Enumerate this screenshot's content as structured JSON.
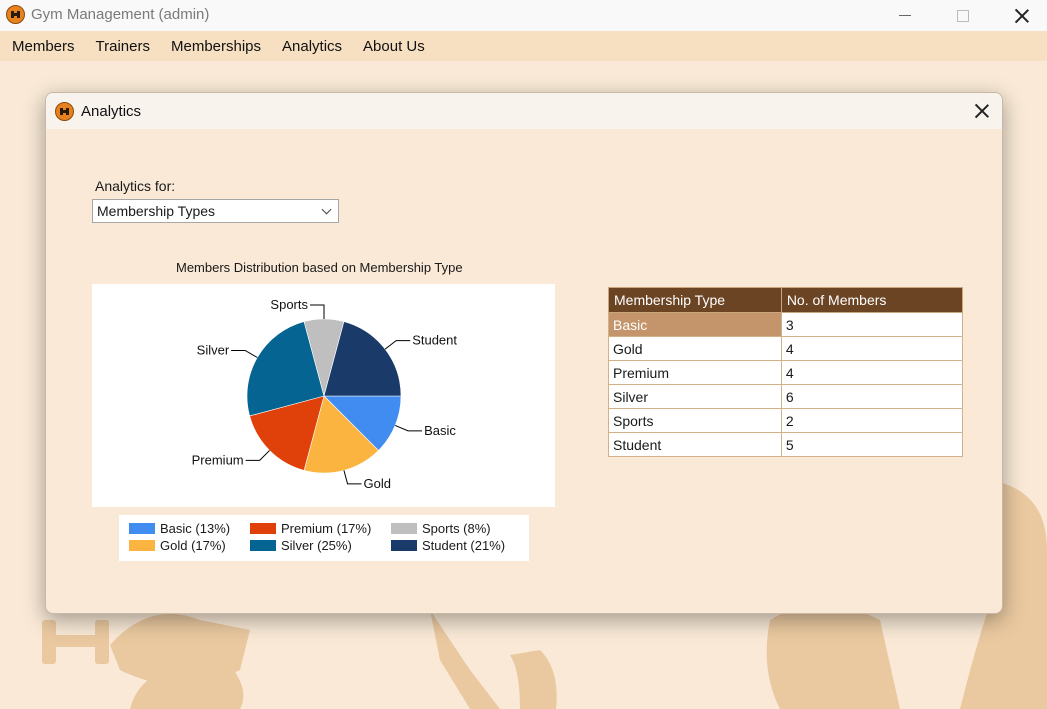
{
  "window": {
    "title": "Gym Management (admin)"
  },
  "menu": [
    "Members",
    "Trainers",
    "Memberships",
    "Analytics",
    "About Us"
  ],
  "dialog": {
    "title": "Analytics",
    "analytics_for_label": "Analytics for:",
    "selected_option": "Membership Types"
  },
  "table": {
    "headers": [
      "Membership Type",
      "No. of Members"
    ],
    "rows": [
      [
        "Basic",
        "3"
      ],
      [
        "Gold",
        "4"
      ],
      [
        "Premium",
        "4"
      ],
      [
        "Silver",
        "6"
      ],
      [
        "Sports",
        "2"
      ],
      [
        "Student",
        "5"
      ]
    ],
    "selected_row": 0
  },
  "colors": {
    "menu_bar": "#f7dfc1",
    "header": "#6b4423",
    "selected": "#c4956a"
  },
  "chart_data": {
    "type": "pie",
    "title": "Members Distribution based on Membership Type",
    "categories": [
      "Basic",
      "Gold",
      "Premium",
      "Silver",
      "Sports",
      "Student"
    ],
    "values": [
      3,
      4,
      4,
      6,
      2,
      5
    ],
    "colors": [
      "#418cf0",
      "#fcb441",
      "#e0400a",
      "#056492",
      "#bfbfbf",
      "#1a3b69"
    ],
    "legend": [
      "Basic (13%)",
      "Premium (17%)",
      "Sports (8%)",
      "Gold (17%)",
      "Silver (25%)",
      "Student (21%)"
    ],
    "legend_placement": "bottom"
  }
}
